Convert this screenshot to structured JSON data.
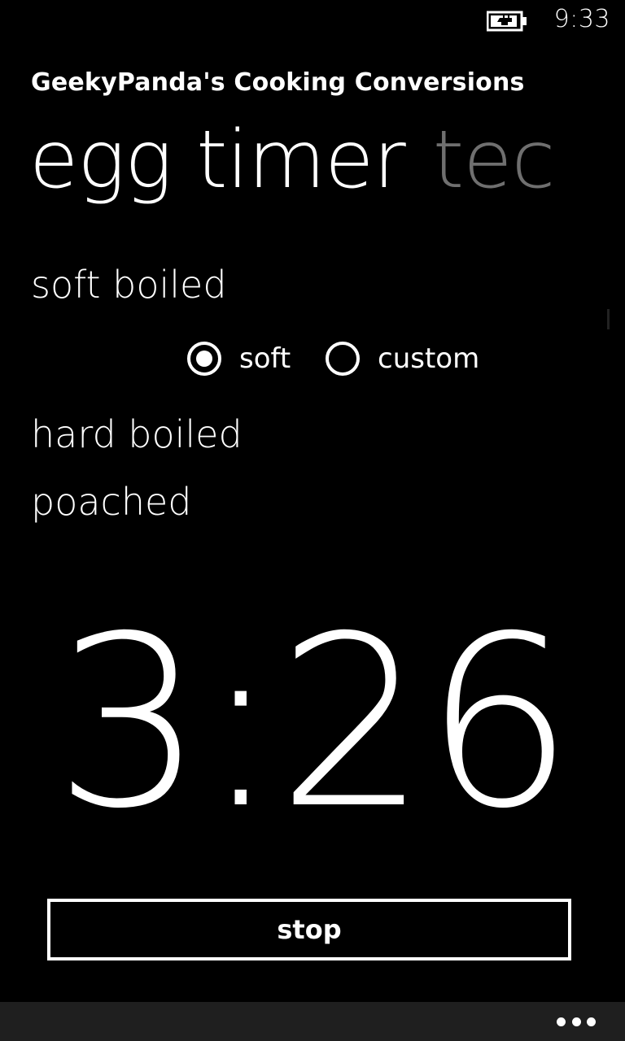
{
  "status_bar": {
    "time": "9:33",
    "battery_icon": "battery-charging-icon"
  },
  "app": {
    "title": "GeekyPanda's Cooking Conversions"
  },
  "pivot": {
    "active_label": "egg timer",
    "next_label": "tec"
  },
  "options": {
    "soft": "soft boiled",
    "hard": "hard boiled",
    "poached": "poached"
  },
  "radio_group": {
    "selected": "soft",
    "items": [
      {
        "label": "soft",
        "selected": true
      },
      {
        "label": "custom",
        "selected": false
      }
    ]
  },
  "timer": {
    "display": "3:26"
  },
  "actions": {
    "stop_label": "stop"
  },
  "app_bar": {
    "more_icon": "more-ellipsis-icon"
  },
  "colors": {
    "background": "#000000",
    "foreground": "#ffffff",
    "inactive_pivot": "#6f6f6f",
    "app_bar": "#1f1f1f"
  }
}
